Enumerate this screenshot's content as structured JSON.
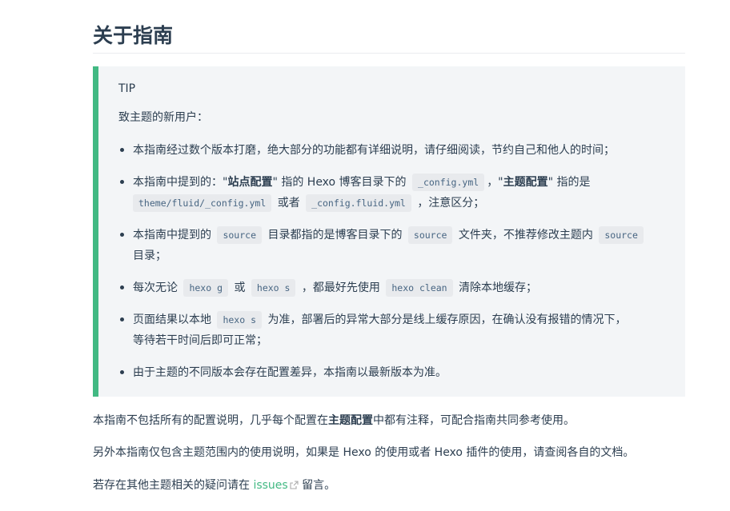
{
  "heading": "关于指南",
  "tip": {
    "title": "TIP",
    "intro": "致主题的新用户：",
    "items": [
      {
        "text": "本指南经过数个版本打磨，绝大部分的功能都有详细说明，请仔细阅读，节约自己和他人的时间；"
      },
      {
        "t1": "本指南中提到的：\"",
        "b1": "站点配置",
        "t2": "\" 指的 Hexo 博客目录下的",
        "c1": "_config.yml",
        "t3": "，\"",
        "b2": "主题配置",
        "t4": "\" 指的是",
        "c2": "theme/fluid/_config.yml",
        "t5": "或者",
        "c3": "_config.fluid.yml",
        "t6": "，注意区分；"
      },
      {
        "t1": "本指南中提到的",
        "c1": "source",
        "t2": "目录都指的是博客目录下的",
        "c2": "source",
        "t3": "文件夹，不推荐修改主题内",
        "c3": "source",
        "t4": "目录；"
      },
      {
        "t1": "每次无论",
        "c1": "hexo g",
        "t2": "或",
        "c2": "hexo s",
        "t3": "，都最好先使用",
        "c3": "hexo clean",
        "t4": "清除本地缓存；"
      },
      {
        "t1": "页面结果以本地",
        "c1": "hexo s",
        "t2": "为准，部署后的异常大部分是线上缓存原因，在确认没有报错的情况下，",
        "t3": "等待若干时间后即可正常；"
      },
      {
        "text": "由于主题的不同版本会存在配置差异，本指南以最新版本为准。"
      }
    ]
  },
  "paragraphs": {
    "p1_before": "本指南不包括所有的配置说明，几乎每个配置在",
    "p1_bold": "主题配置",
    "p1_after": "中都有注释，可配合指南共同参考使用。",
    "p2": "另外本指南仅包含主题范围内的使用说明，如果是 Hexo 的使用或者 Hexo 插件的使用，请查阅各自的文档。",
    "p3_before": "若存在其他主题相关的疑问请在",
    "p3_link": "issues",
    "p3_after": "留言。"
  },
  "colors": {
    "accent": "#42b983",
    "text": "#2c3e50",
    "tip_bg": "#f3f5f7"
  }
}
